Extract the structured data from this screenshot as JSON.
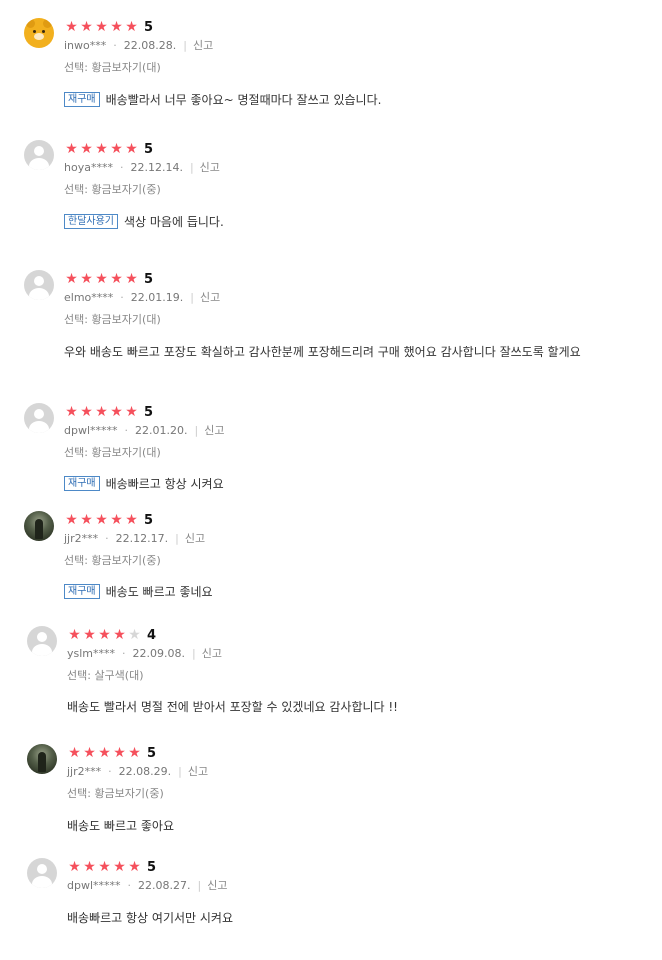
{
  "common": {
    "report_label": "신고",
    "star_full": "★",
    "star_empty": "★",
    "star_color": "#f5505c",
    "star_empty_color": "#d7d7d7",
    "badge_color": "#2e6db4"
  },
  "reviews": [
    {
      "avatar": "bear-avatar",
      "rating": 5,
      "score": "5",
      "user": "inwo***",
      "date": "22.08.28.",
      "option": "선택: 황금보자기(대)",
      "badge": "재구매",
      "text": "배송빨라서 너무 좋아요~ 명절때마다 잘쓰고 있습니다."
    },
    {
      "avatar": "default-avatar",
      "rating": 5,
      "score": "5",
      "user": "hoya****",
      "date": "22.12.14.",
      "option": "선택: 황금보자기(중)",
      "badge": "한달사용기",
      "text": "색상 마음에 듭니다."
    },
    {
      "avatar": "default-avatar",
      "rating": 5,
      "score": "5",
      "user": "elmo****",
      "date": "22.01.19.",
      "option": "선택: 황금보자기(대)",
      "badge": "",
      "text": "우와 배송도 빠르고 포장도 확실하고 감사한분께 포장해드리려 구매 했어요 감사합니다 잘쓰도록 할게요"
    },
    {
      "avatar": "default-avatar",
      "rating": 5,
      "score": "5",
      "user": "dpwl*****",
      "date": "22.01.20.",
      "option": "선택: 황금보자기(대)",
      "badge": "재구매",
      "text": "배송빠르고 항상 시켜요"
    },
    {
      "avatar": "photo-avatar",
      "rating": 5,
      "score": "5",
      "user": "jjr2***",
      "date": "22.12.17.",
      "option": "선택: 황금보자기(중)",
      "badge": "재구매",
      "text": "배송도 빠르고 좋네요"
    },
    {
      "avatar": "default-avatar",
      "rating": 4,
      "score": "4",
      "user": "yslm****",
      "date": "22.09.08.",
      "option": "선택: 살구색(대)",
      "badge": "",
      "text": "배송도 빨라서 명절 전에 받아서 포장할 수 있겠네요 감사합니다 !!"
    },
    {
      "avatar": "photo-avatar",
      "rating": 5,
      "score": "5",
      "user": "jjr2***",
      "date": "22.08.29.",
      "option": "선택: 황금보자기(중)",
      "badge": "",
      "text": "배송도 빠르고 좋아요"
    },
    {
      "avatar": "default-avatar",
      "rating": 5,
      "score": "5",
      "user": "dpwl*****",
      "date": "22.08.27.",
      "option": "",
      "badge": "",
      "text": "배송빠르고 항상 여기서만 시켜요"
    }
  ]
}
